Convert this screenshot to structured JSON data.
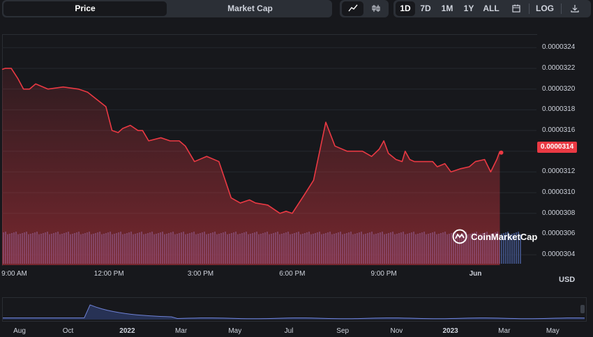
{
  "tabs": {
    "price": "Price",
    "market_cap": "Market Cap",
    "active": "price"
  },
  "chart_type_buttons": [
    {
      "icon": "line-chart-icon",
      "active": true
    },
    {
      "icon": "candlestick-icon",
      "active": false
    }
  ],
  "range_buttons": [
    "1D",
    "7D",
    "1M",
    "1Y",
    "ALL"
  ],
  "active_range": "1D",
  "extra_buttons": {
    "calendar_icon": "calendar-icon",
    "log_label": "LOG",
    "download_icon": "download-icon"
  },
  "currency": "USD",
  "watermark": "CoinMarketCap",
  "colors": {
    "line": "#ea3943",
    "fill": "#ea3943",
    "volume": "#3d4d7c",
    "badge": "#ea3943",
    "nav_line": "#6f82d6"
  },
  "chart_data": {
    "type": "area",
    "y_ticks": [
      "0.0000324",
      "0.0000322",
      "0.0000320",
      "0.0000318",
      "0.0000316",
      "0.0000314",
      "0.0000312",
      "0.0000310",
      "0.0000308",
      "0.0000306",
      "0.0000304"
    ],
    "ylim": [
      3.03e-05,
      3.253e-05
    ],
    "current_price": "0.0000314",
    "x_ticks": [
      "9:00 AM",
      "12:00 PM",
      "3:00 PM",
      "6:00 PM",
      "9:00 PM",
      "Jun"
    ],
    "x_ticks_bold": [
      "Jun"
    ],
    "x_hours": [
      -4.1,
      -1.0,
      2.0,
      5.0,
      8.0,
      11.0
    ],
    "hours": [
      -4.5,
      -4.4,
      -4.2,
      -3.98,
      -3.8,
      -3.6,
      -3.4,
      -3.0,
      -2.5,
      -2.0,
      -1.7,
      -1.4,
      -1.1,
      -0.9,
      -0.7,
      -0.55,
      -0.3,
      -0.05,
      0.1,
      0.3,
      0.7,
      1.0,
      1.3,
      1.5,
      1.8,
      2.2,
      2.6,
      3.0,
      3.3,
      3.6,
      3.8,
      4.2,
      4.6,
      4.8,
      5.0,
      5.4,
      5.7,
      6.1,
      6.4,
      6.8,
      7.1,
      7.3,
      7.6,
      7.85,
      8.0,
      8.15,
      8.4,
      8.6,
      8.7,
      8.85,
      9.0,
      9.3,
      9.6,
      9.75,
      10.0,
      10.2,
      10.5,
      10.8,
      11.0,
      11.3,
      11.5,
      11.7,
      11.8
    ],
    "values": [
      3.219e-05,
      3.22e-05,
      3.22e-05,
      3.21e-05,
      3.2e-05,
      3.2e-05,
      3.205e-05,
      3.2e-05,
      3.202e-05,
      3.2e-05,
      3.197e-05,
      3.19e-05,
      3.183e-05,
      3.16e-05,
      3.158e-05,
      3.162e-05,
      3.165e-05,
      3.16e-05,
      3.16e-05,
      3.15e-05,
      3.153e-05,
      3.15e-05,
      3.15e-05,
      3.145e-05,
      3.13e-05,
      3.135e-05,
      3.13e-05,
      3.095e-05,
      3.09e-05,
      3.093e-05,
      3.09e-05,
      3.088e-05,
      3.08e-05,
      3.082e-05,
      3.08e-05,
      3.098e-05,
      3.112e-05,
      3.168e-05,
      3.145e-05,
      3.14e-05,
      3.14e-05,
      3.14e-05,
      3.135e-05,
      3.142e-05,
      3.15e-05,
      3.138e-05,
      3.132e-05,
      3.13e-05,
      3.14e-05,
      3.132e-05,
      3.13e-05,
      3.13e-05,
      3.13e-05,
      3.125e-05,
      3.128e-05,
      3.12e-05,
      3.123e-05,
      3.125e-05,
      3.13e-05,
      3.132e-05,
      3.12e-05,
      3.132e-05,
      3.14e-05
    ]
  },
  "navigator": {
    "labels": [
      "Aug",
      "Oct",
      "2022",
      "Mar",
      "May",
      "Jul",
      "Sep",
      "Nov",
      "2023",
      "Mar",
      "May"
    ],
    "bold_labels": [
      "2022",
      "2023"
    ],
    "label_positions": [
      0.0,
      0.09,
      0.2,
      0.3,
      0.4,
      0.5,
      0.6,
      0.7,
      0.8,
      0.9,
      0.99
    ]
  }
}
